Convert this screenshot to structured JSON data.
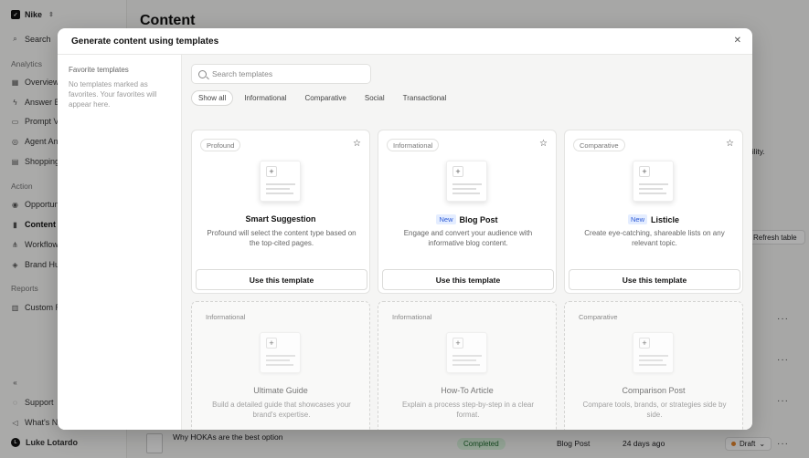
{
  "app": {
    "workspace": "Nike",
    "page_title": "Content",
    "search_label": "Search",
    "sections": {
      "analytics": "Analytics",
      "action": "Action",
      "reports": "Reports"
    },
    "analytics_items": [
      "Overview",
      "Answer E",
      "Prompt V",
      "Agent Ana",
      "Shopping"
    ],
    "action_items": [
      "Opportun",
      "Content",
      "Workflow",
      "Brand Hu"
    ],
    "reports_items": [
      "Custom R"
    ],
    "bottom_items": [
      "Support",
      "What's N"
    ],
    "user_name": "Luke Lotardo",
    "bg_text": "bility.",
    "refresh_label": "Refresh table",
    "row": {
      "title": "Why HOKAs are the best option",
      "status": "Completed",
      "type": "Blog Post",
      "age": "24 days ago",
      "state": "Draft"
    },
    "draft_letter": "t"
  },
  "modal": {
    "title": "Generate content using templates",
    "favorites_title": "Favorite templates",
    "favorites_empty": "No templates marked as favorites. Your favorites will appear here.",
    "search_placeholder": "Search templates",
    "filters": [
      "Show all",
      "Informational",
      "Comparative",
      "Social",
      "Transactional"
    ],
    "active_filter": "Show all",
    "use_label": "Use this template",
    "new_label": "New",
    "cards": [
      {
        "tag": "Profound",
        "title": "Smart Suggestion",
        "desc": "Profound will select the content type based on the top-cited pages."
      },
      {
        "tag": "Informational",
        "title": "Blog Post",
        "desc": "Engage and convert your audience with informative blog content."
      },
      {
        "tag": "Comparative",
        "title": "Listicle",
        "desc": "Create eye-catching, shareable lists on any relevant topic."
      },
      {
        "tag": "Informational",
        "title": "Ultimate Guide",
        "desc": "Build a detailed guide that showcases your brand's expertise."
      },
      {
        "tag": "Informational",
        "title": "How-To Article",
        "desc": "Explain a process step-by-step in a clear format."
      },
      {
        "tag": "Comparative",
        "title": "Comparison Post",
        "desc": "Compare tools, brands, or strategies side by side."
      }
    ]
  }
}
